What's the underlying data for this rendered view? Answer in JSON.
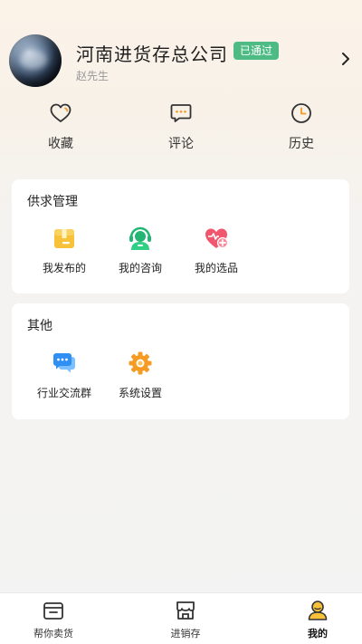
{
  "profile": {
    "company_name": "河南进货存总公司",
    "status_badge": "已通过",
    "user_name": "赵先生"
  },
  "quick_actions": [
    {
      "label": "收藏",
      "icon": "heart-outline-icon"
    },
    {
      "label": "评论",
      "icon": "comment-icon"
    },
    {
      "label": "历史",
      "icon": "clock-icon"
    }
  ],
  "supply_section": {
    "title": "供求管理",
    "items": [
      {
        "label": "我发布的",
        "icon": "package-icon"
      },
      {
        "label": "我的咨询",
        "icon": "customer-service-icon"
      },
      {
        "label": "我的选品",
        "icon": "heart-plus-icon"
      }
    ]
  },
  "other_section": {
    "title": "其他",
    "items": [
      {
        "label": "行业交流群",
        "icon": "chat-bubbles-icon"
      },
      {
        "label": "系统设置",
        "icon": "settings-gear-icon"
      }
    ]
  },
  "tabbar": {
    "items": [
      {
        "label": "帮你卖货",
        "icon": "shop-box-icon",
        "active": false
      },
      {
        "label": "进销存",
        "icon": "store-icon",
        "active": false
      },
      {
        "label": "我的",
        "icon": "user-icon",
        "active": true
      }
    ]
  },
  "colors": {
    "badge": "#4dbb83",
    "accent_yellow": "#f7c23a",
    "accent_green": "#22b573",
    "accent_pink": "#f0566e",
    "accent_blue": "#2f8ff3",
    "accent_orange": "#f59b23"
  }
}
